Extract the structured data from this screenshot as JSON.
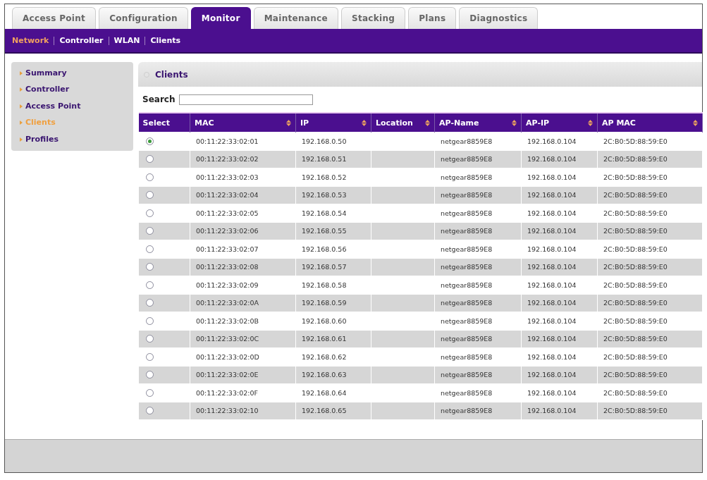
{
  "tabs": [
    {
      "label": "Access Point",
      "selected": false
    },
    {
      "label": "Configuration",
      "selected": false
    },
    {
      "label": "Monitor",
      "selected": true
    },
    {
      "label": "Maintenance",
      "selected": false
    },
    {
      "label": "Stacking",
      "selected": false
    },
    {
      "label": "Plans",
      "selected": false
    },
    {
      "label": "Diagnostics",
      "selected": false
    }
  ],
  "subnav": [
    {
      "label": "Network",
      "selected": true
    },
    {
      "label": "Controller",
      "selected": false
    },
    {
      "label": "WLAN",
      "selected": false
    },
    {
      "label": "Clients",
      "selected": false
    }
  ],
  "sidebar": {
    "items": [
      {
        "label": "Summary",
        "selected": false
      },
      {
        "label": "Controller",
        "selected": false
      },
      {
        "label": "Access Point",
        "selected": false
      },
      {
        "label": "Clients",
        "selected": true
      },
      {
        "label": "Profiles",
        "selected": false
      }
    ]
  },
  "panel": {
    "title": "Clients",
    "search": {
      "label": "Search"
    },
    "table": {
      "columns": [
        {
          "label": "Select",
          "sortable": false
        },
        {
          "label": "MAC",
          "sortable": true
        },
        {
          "label": "IP",
          "sortable": true
        },
        {
          "label": "Location",
          "sortable": true
        },
        {
          "label": "AP-Name",
          "sortable": true
        },
        {
          "label": "AP-IP",
          "sortable": true
        },
        {
          "label": "AP MAC",
          "sortable": true
        }
      ],
      "rows": [
        {
          "selected": true,
          "mac": "00:11:22:33:02:01",
          "ip": "192.168.0.50",
          "ap_name": "netgear8859E8",
          "ap_ip": "192.168.0.104",
          "ap_mac": "2C:B0:5D:88:59:E0"
        },
        {
          "selected": false,
          "mac": "00:11:22:33:02:02",
          "ip": "192.168.0.51",
          "ap_name": "netgear8859E8",
          "ap_ip": "192.168.0.104",
          "ap_mac": "2C:B0:5D:88:59:E0"
        },
        {
          "selected": false,
          "mac": "00:11:22:33:02:03",
          "ip": "192.168.0.52",
          "ap_name": "netgear8859E8",
          "ap_ip": "192.168.0.104",
          "ap_mac": "2C:B0:5D:88:59:E0"
        },
        {
          "selected": false,
          "mac": "00:11:22:33:02:04",
          "ip": "192.168.0.53",
          "ap_name": "netgear8859E8",
          "ap_ip": "192.168.0.104",
          "ap_mac": "2C:B0:5D:88:59:E0"
        },
        {
          "selected": false,
          "mac": "00:11:22:33:02:05",
          "ip": "192.168.0.54",
          "ap_name": "netgear8859E8",
          "ap_ip": "192.168.0.104",
          "ap_mac": "2C:B0:5D:88:59:E0"
        },
        {
          "selected": false,
          "mac": "00:11:22:33:02:06",
          "ip": "192.168.0.55",
          "ap_name": "netgear8859E8",
          "ap_ip": "192.168.0.104",
          "ap_mac": "2C:B0:5D:88:59:E0"
        },
        {
          "selected": false,
          "mac": "00:11:22:33:02:07",
          "ip": "192.168.0.56",
          "ap_name": "netgear8859E8",
          "ap_ip": "192.168.0.104",
          "ap_mac": "2C:B0:5D:88:59:E0"
        },
        {
          "selected": false,
          "mac": "00:11:22:33:02:08",
          "ip": "192.168.0.57",
          "ap_name": "netgear8859E8",
          "ap_ip": "192.168.0.104",
          "ap_mac": "2C:B0:5D:88:59:E0"
        },
        {
          "selected": false,
          "mac": "00:11:22:33:02:09",
          "ip": "192.168.0.58",
          "ap_name": "netgear8859E8",
          "ap_ip": "192.168.0.104",
          "ap_mac": "2C:B0:5D:88:59:E0"
        },
        {
          "selected": false,
          "mac": "00:11:22:33:02:0A",
          "ip": "192.168.0.59",
          "ap_name": "netgear8859E8",
          "ap_ip": "192.168.0.104",
          "ap_mac": "2C:B0:5D:88:59:E0"
        },
        {
          "selected": false,
          "mac": "00:11:22:33:02:0B",
          "ip": "192.168.0.60",
          "ap_name": "netgear8859E8",
          "ap_ip": "192.168.0.104",
          "ap_mac": "2C:B0:5D:88:59:E0"
        },
        {
          "selected": false,
          "mac": "00:11:22:33:02:0C",
          "ip": "192.168.0.61",
          "ap_name": "netgear8859E8",
          "ap_ip": "192.168.0.104",
          "ap_mac": "2C:B0:5D:88:59:E0"
        },
        {
          "selected": false,
          "mac": "00:11:22:33:02:0D",
          "ip": "192.168.0.62",
          "ap_name": "netgear8859E8",
          "ap_ip": "192.168.0.104",
          "ap_mac": "2C:B0:5D:88:59:E0"
        },
        {
          "selected": false,
          "mac": "00:11:22:33:02:0E",
          "ip": "192.168.0.63",
          "ap_name": "netgear8859E8",
          "ap_ip": "192.168.0.104",
          "ap_mac": "2C:B0:5D:88:59:E0"
        },
        {
          "selected": false,
          "mac": "00:11:22:33:02:0F",
          "ip": "192.168.0.64",
          "ap_name": "netgear8859E8",
          "ap_ip": "192.168.0.104",
          "ap_mac": "2C:B0:5D:88:59:E0"
        },
        {
          "selected": false,
          "mac": "00:11:22:33:02:10",
          "ip": "192.168.0.65",
          "ap_name": "netgear8859E8",
          "ap_ip": "192.168.0.104",
          "ap_mac": "2C:B0:5D:88:59:E0"
        }
      ]
    }
  }
}
